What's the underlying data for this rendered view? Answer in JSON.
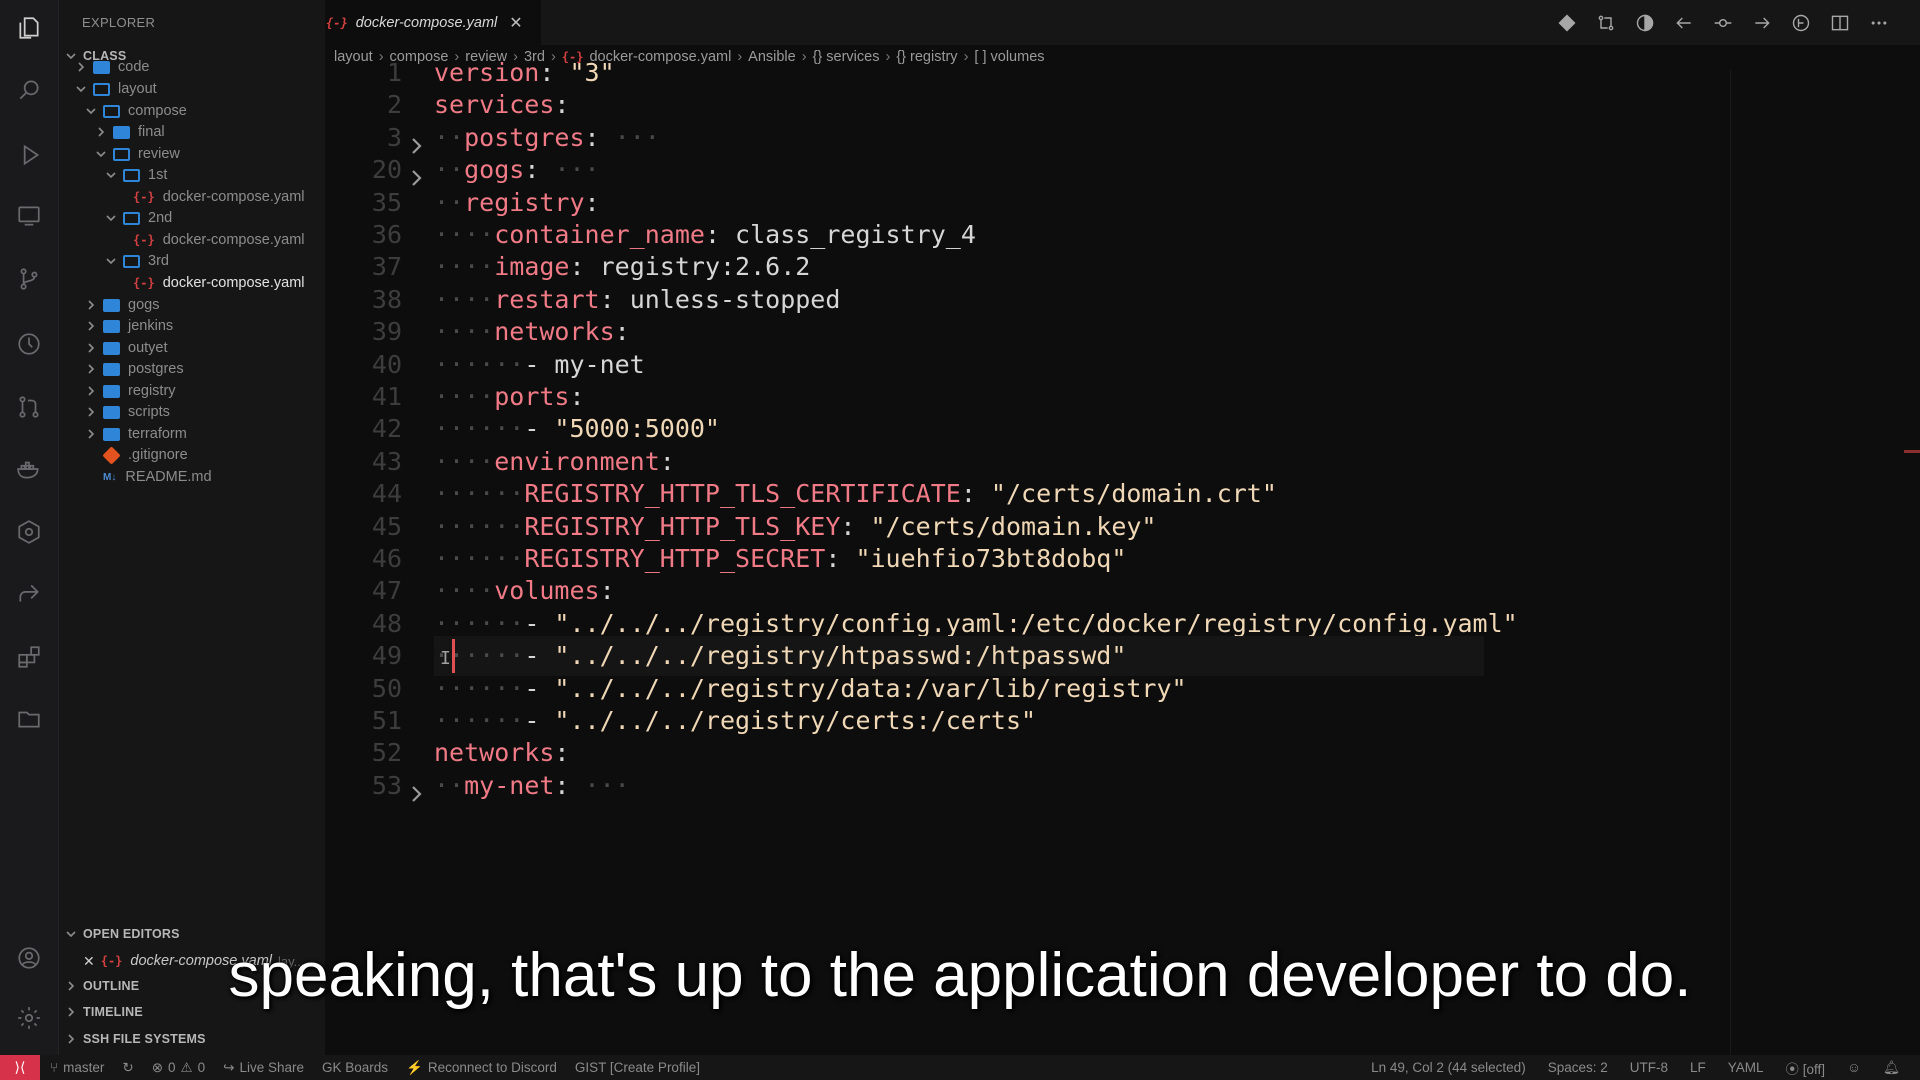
{
  "colors": {
    "accent_folder": "#2f86d8",
    "yaml_icon": "#d24040",
    "key": "#f07a86",
    "string": "#f0d8b6",
    "status_remote": "#d6334a"
  },
  "sidebar": {
    "title": "EXPLORER",
    "root": "CLASS",
    "items": [
      {
        "label": "code",
        "type": "folder",
        "expanded": false
      },
      {
        "label": "layout",
        "type": "folder",
        "expanded": true
      },
      {
        "label": "compose",
        "type": "folder",
        "expanded": true
      },
      {
        "label": "final",
        "type": "folder",
        "expanded": false
      },
      {
        "label": "review",
        "type": "folder",
        "expanded": true
      },
      {
        "label": "1st",
        "type": "folder",
        "expanded": true
      },
      {
        "label": "docker-compose.yaml",
        "type": "yaml"
      },
      {
        "label": "2nd",
        "type": "folder",
        "expanded": true
      },
      {
        "label": "docker-compose.yaml",
        "type": "yaml"
      },
      {
        "label": "3rd",
        "type": "folder",
        "expanded": true
      },
      {
        "label": "docker-compose.yaml",
        "type": "yaml",
        "selected": true
      },
      {
        "label": "gogs",
        "type": "folder",
        "expanded": false
      },
      {
        "label": "jenkins",
        "type": "folder",
        "expanded": false
      },
      {
        "label": "outyet",
        "type": "folder",
        "expanded": false
      },
      {
        "label": "postgres",
        "type": "folder",
        "expanded": false
      },
      {
        "label": "registry",
        "type": "folder",
        "expanded": false
      },
      {
        "label": "scripts",
        "type": "folder",
        "expanded": false
      },
      {
        "label": "terraform",
        "type": "folder",
        "expanded": false
      },
      {
        "label": ".gitignore",
        "type": "git"
      },
      {
        "label": "README.md",
        "type": "md"
      }
    ],
    "open_editors": {
      "title": "OPEN EDITORS",
      "file": "docker-compose.yaml",
      "hint": "lay..."
    },
    "sections": [
      "OUTLINE",
      "TIMELINE",
      "SSH FILE SYSTEMS"
    ]
  },
  "tab": {
    "label": "docker-compose.yaml",
    "close": "✕"
  },
  "breadcrumb": [
    "layout",
    "compose",
    "review",
    "3rd",
    "docker-compose.yaml",
    "Ansible",
    "{} services",
    "{} registry",
    "[ ] volumes"
  ],
  "editor": {
    "lines": [
      {
        "n": "1",
        "indent": 0,
        "key": "version",
        "val": "\"3\"",
        "vtype": "s"
      },
      {
        "n": "2",
        "indent": 0,
        "key": "services",
        "val": ""
      },
      {
        "n": "3",
        "indent": 1,
        "key": "postgres",
        "val": "···",
        "folded": true
      },
      {
        "n": "20",
        "indent": 1,
        "key": "gogs",
        "val": "···",
        "folded": true
      },
      {
        "n": "35",
        "indent": 1,
        "key": "registry",
        "val": ""
      },
      {
        "n": "36",
        "indent": 2,
        "key": "container_name",
        "val": "class_registry_4",
        "vtype": "v"
      },
      {
        "n": "37",
        "indent": 2,
        "key": "image",
        "val": "registry:2.6.2",
        "vtype": "v"
      },
      {
        "n": "38",
        "indent": 2,
        "key": "restart",
        "val": "unless-stopped",
        "vtype": "v"
      },
      {
        "n": "39",
        "indent": 2,
        "key": "networks",
        "val": ""
      },
      {
        "n": "40",
        "indent": 3,
        "dash": true,
        "val": "my-net",
        "vtype": "v"
      },
      {
        "n": "41",
        "indent": 2,
        "key": "ports",
        "val": ""
      },
      {
        "n": "42",
        "indent": 3,
        "dash": true,
        "val": "\"5000:5000\"",
        "vtype": "s"
      },
      {
        "n": "43",
        "indent": 2,
        "key": "environment",
        "val": ""
      },
      {
        "n": "44",
        "indent": 3,
        "key": "REGISTRY_HTTP_TLS_CERTIFICATE",
        "val": "\"/certs/domain.crt\"",
        "vtype": "s"
      },
      {
        "n": "45",
        "indent": 3,
        "key": "REGISTRY_HTTP_TLS_KEY",
        "val": "\"/certs/domain.key\"",
        "vtype": "s"
      },
      {
        "n": "46",
        "indent": 3,
        "key": "REGISTRY_HTTP_SECRET",
        "val": "\"iuehfio73bt8dobq\"",
        "vtype": "s"
      },
      {
        "n": "47",
        "indent": 2,
        "key": "volumes",
        "val": ""
      },
      {
        "n": "48",
        "indent": 3,
        "dash": true,
        "val": "\"../../../registry/config.yaml:/etc/docker/registry/config.yaml\"",
        "vtype": "s"
      },
      {
        "n": "49",
        "indent": 3,
        "dash": true,
        "val": "\"../../../registry/htpasswd:/htpasswd\"",
        "vtype": "s",
        "current": true
      },
      {
        "n": "50",
        "indent": 3,
        "dash": true,
        "val": "\"../../../registry/data:/var/lib/registry\"",
        "vtype": "s"
      },
      {
        "n": "51",
        "indent": 3,
        "dash": true,
        "val": "\"../../../registry/certs:/certs\"",
        "vtype": "s"
      },
      {
        "n": "52",
        "indent": 0,
        "key": "networks",
        "val": ""
      },
      {
        "n": "53",
        "indent": 1,
        "key": "my-net",
        "val": "···",
        "folded": true
      }
    ]
  },
  "caption": "speaking, that's up to the application developer to do.",
  "statusbar": {
    "branch": "master",
    "errors": "0",
    "warnings": "0",
    "live_share": "Live Share",
    "gk_boards": "GK Boards",
    "discord": "Reconnect to Discord",
    "gist": "GIST [Create Profile]",
    "position": "Ln 49, Col 2 (44 selected)",
    "spaces": "Spaces: 2",
    "encoding": "UTF-8",
    "eol": "LF",
    "language": "YAML",
    "off": "[off]"
  }
}
